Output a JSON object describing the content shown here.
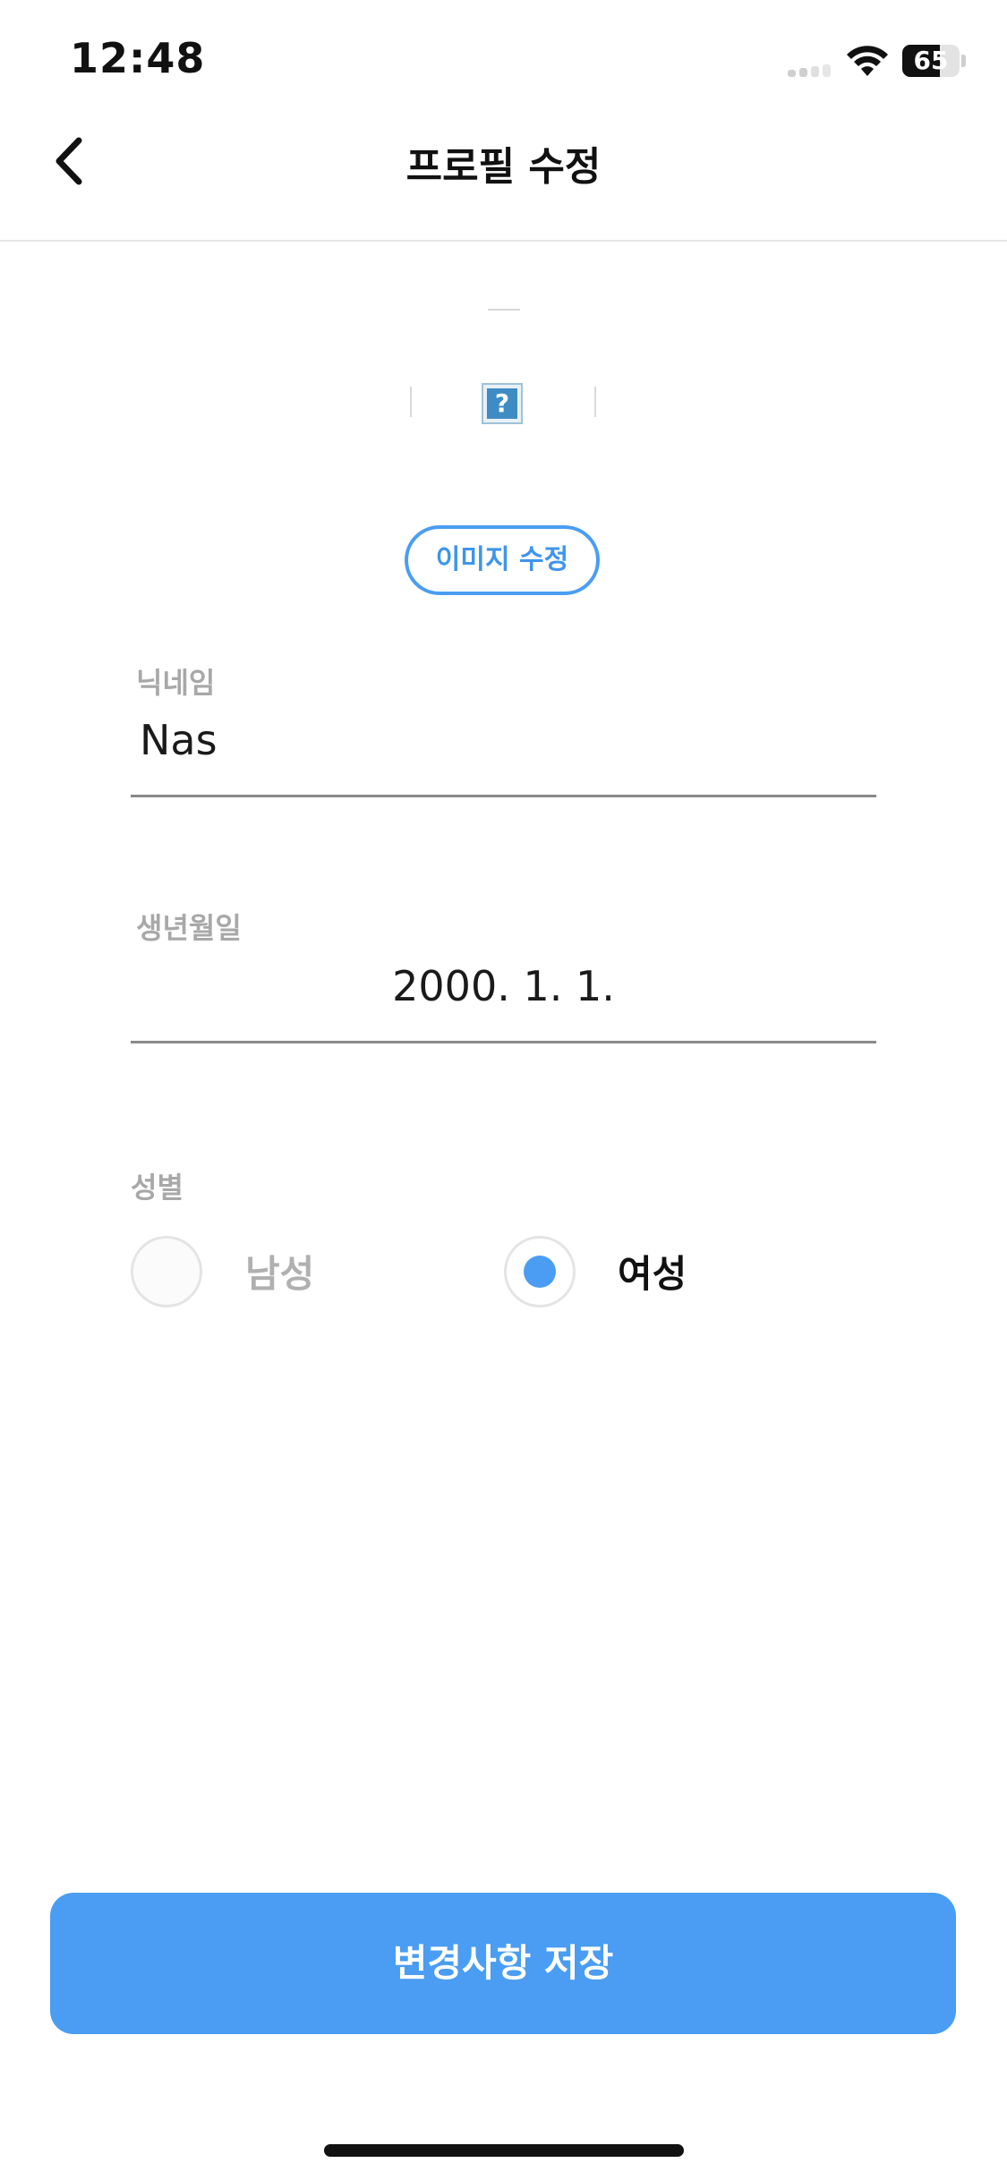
{
  "status_bar": {
    "time": "12:48",
    "battery_level": "65",
    "battery_fraction": 0.65,
    "icons": [
      "signal-icon",
      "wifi-icon",
      "battery-icon"
    ]
  },
  "nav": {
    "back_icon": "chevron-left-icon",
    "title": "프로필 수정"
  },
  "profile_image": {
    "placeholder_glyph": "?",
    "edit_label": "이미지 수정"
  },
  "form": {
    "nickname": {
      "label": "닉네임",
      "value": "Nas"
    },
    "birthdate": {
      "label": "생년월일",
      "value": "2000. 1. 1."
    },
    "gender": {
      "label": "성별",
      "options": [
        {
          "label": "남성",
          "selected": false
        },
        {
          "label": "여성",
          "selected": true
        }
      ]
    }
  },
  "footer": {
    "save_label": "변경사항 저장"
  },
  "colors": {
    "accent": "#4a9df2",
    "label_gray": "#a8a8a8",
    "text": "#1a1a1a"
  }
}
